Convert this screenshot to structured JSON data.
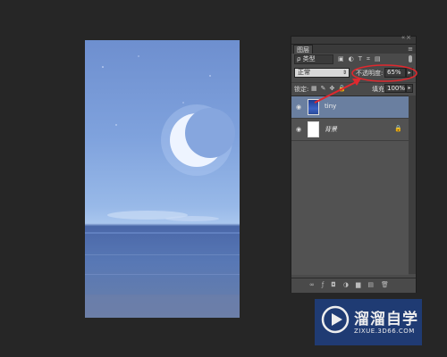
{
  "panel": {
    "tab_label": "图层",
    "filter_label": "ρ 类型",
    "blend_mode": "正常",
    "opacity_label": "不透明度:",
    "opacity_value": "65%",
    "lock_label": "锁定:",
    "fill_label": "填充:",
    "fill_value": "100%",
    "layers": [
      {
        "name": "tiny",
        "selected": true,
        "thumbnail": "blue-photo"
      },
      {
        "name": "背景",
        "selected": false,
        "thumbnail": "white",
        "locked": true
      }
    ]
  },
  "watermark": {
    "title": "溜溜自学",
    "url": "ZIXUE.3D66.COM"
  },
  "annotation_color": "#e0282e"
}
